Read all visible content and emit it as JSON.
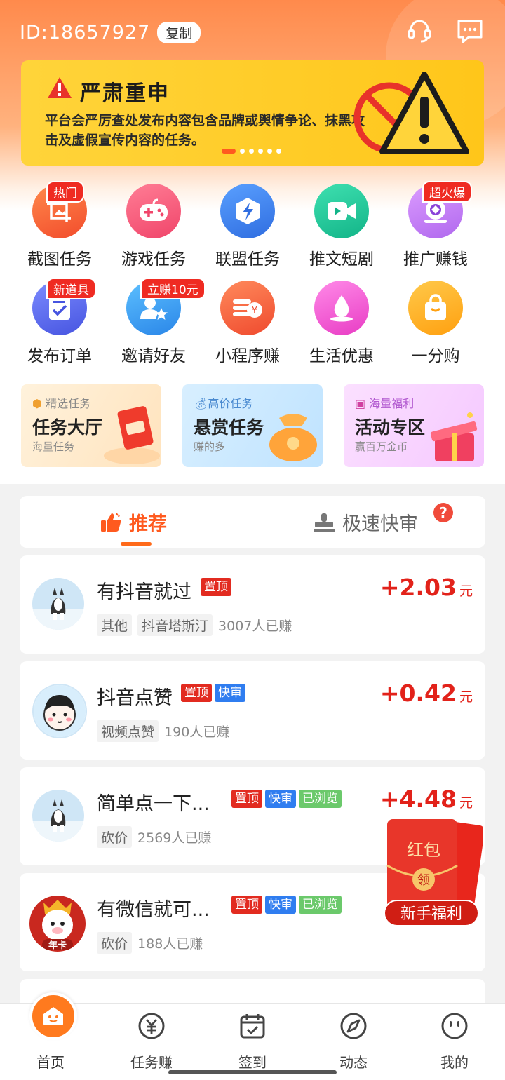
{
  "header": {
    "user_id": "ID:18657927",
    "copy_label": "复制",
    "icons": [
      "headset-icon",
      "message-icon"
    ]
  },
  "banner": {
    "title": "严肃重申",
    "text": "平台会严厉查处发布内容包含品牌或舆情争论、抹黑攻击及虚假宣传内容的任务。",
    "slide_count": 6,
    "active_slide": 1
  },
  "grid": [
    {
      "label": "截图任务",
      "tag": "热门",
      "color": "#ff6a3a",
      "icon": "screenshot-icon"
    },
    {
      "label": "游戏任务",
      "tag": "",
      "color": "#ff5a7a",
      "icon": "gamepad-icon"
    },
    {
      "label": "联盟任务",
      "tag": "",
      "color": "#3b82f0",
      "icon": "lightning-icon"
    },
    {
      "label": "推文短剧",
      "tag": "",
      "color": "#20c99a",
      "icon": "video-icon"
    },
    {
      "label": "推广赚钱",
      "tag": "超火爆",
      "color": "#c77cf0",
      "icon": "promote-icon"
    },
    {
      "label": "发布订单",
      "tag": "新道具",
      "color": "#5a6cf0",
      "icon": "order-icon"
    },
    {
      "label": "邀请好友",
      "tag": "立赚10元",
      "color": "#3aa0f0",
      "icon": "invite-icon"
    },
    {
      "label": "小程序赚",
      "tag": "",
      "color": "#ff6a3a",
      "icon": "coin-stack-icon"
    },
    {
      "label": "生活优惠",
      "tag": "",
      "color": "#f05ad0",
      "icon": "drop-icon"
    },
    {
      "label": "一分购",
      "tag": "",
      "color": "#ffb020",
      "icon": "shopping-bag-icon"
    }
  ],
  "promos": [
    {
      "small": "精选任务",
      "big": "任务大厅",
      "sub": "海量任务"
    },
    {
      "small": "高价任务",
      "big": "悬赏任务",
      "sub": "赚的多"
    },
    {
      "small": "海量福利",
      "big": "活动专区",
      "sub": "赢百万金币"
    }
  ],
  "tabs": {
    "recommend": "推荐",
    "fast_review": "极速快审",
    "help": "?"
  },
  "tasks": [
    {
      "title": "有抖音就过",
      "badges": [
        "置顶"
      ],
      "chips": [
        "其他",
        "抖音塔斯汀"
      ],
      "earned": "3007人已赚",
      "reward": "+2.03",
      "unit": "元"
    },
    {
      "title": "抖音点赞",
      "badges": [
        "置顶",
        "快审"
      ],
      "chips": [
        "视频点赞"
      ],
      "earned": "190人已赚",
      "reward": "+0.42",
      "unit": "元"
    },
    {
      "title": "简单点一下...",
      "badges": [
        "置顶",
        "快审",
        "已浏览"
      ],
      "chips": [
        "砍价"
      ],
      "earned": "2569人已赚",
      "reward": "+4.48",
      "unit": "元"
    },
    {
      "title": "有微信就可...",
      "badges": [
        "置顶",
        "快审",
        "已浏览"
      ],
      "chips": [
        "砍价"
      ],
      "earned": "188人已赚",
      "reward": "",
      "unit": ""
    }
  ],
  "avatar_labels": {
    "year_card": "年卡"
  },
  "redpacket": {
    "title": "红包",
    "seal": "领",
    "ribbon": "新手福利"
  },
  "bottom_nav": [
    {
      "label": "首页",
      "icon": "home-icon"
    },
    {
      "label": "任务赚",
      "icon": "yuan-icon"
    },
    {
      "label": "签到",
      "icon": "calendar-check-icon"
    },
    {
      "label": "动态",
      "icon": "compass-icon"
    },
    {
      "label": "我的",
      "icon": "smile-icon"
    }
  ]
}
